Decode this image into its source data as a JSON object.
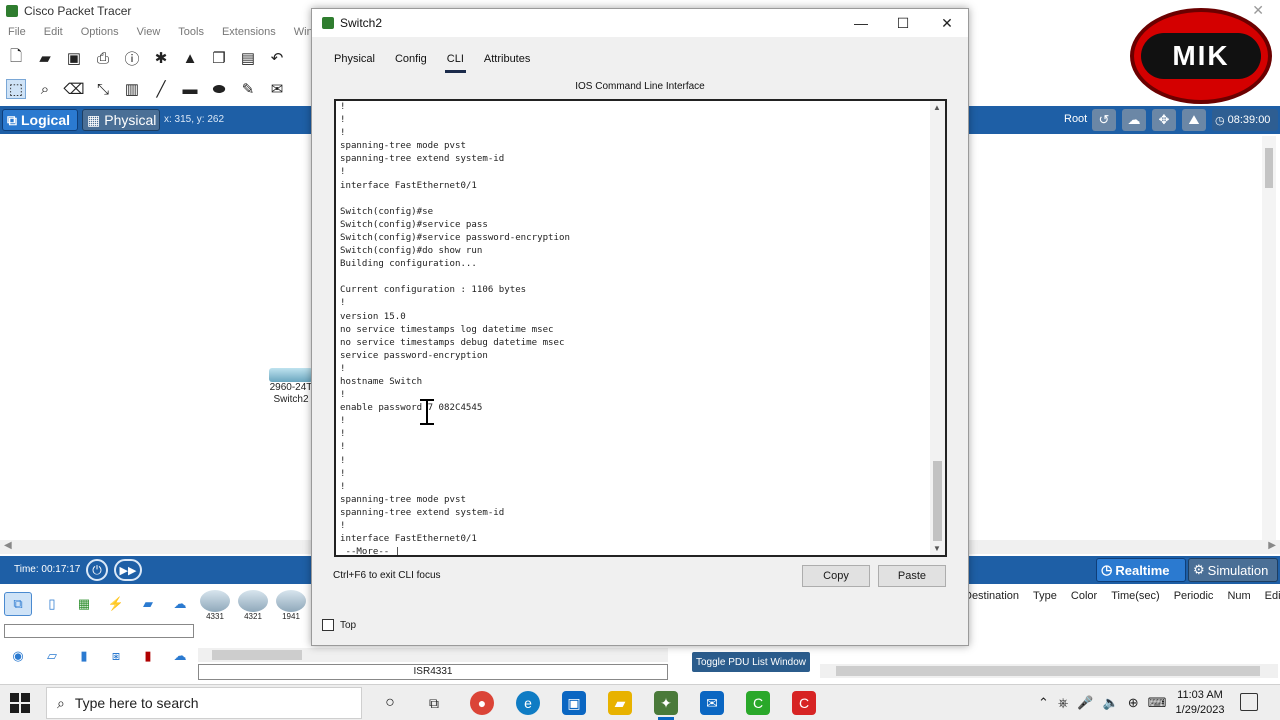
{
  "app": {
    "title": "Cisco Packet Tracer",
    "menu": [
      "File",
      "Edit",
      "Options",
      "View",
      "Tools",
      "Extensions",
      "Window"
    ]
  },
  "workspace": {
    "logical_label": "Logical",
    "physical_label": "Physical",
    "coords": "x: 315, y: 262",
    "root_label": "Root",
    "clock": "08:39:00"
  },
  "canvas": {
    "device_model": "2960-24T",
    "device_name": "Switch2"
  },
  "timebar": {
    "time": "Time: 00:17:17",
    "realtime_label": "Realtime",
    "simulation_label": "Simulation"
  },
  "device_models": [
    {
      "label": "4331"
    },
    {
      "label": "4321"
    },
    {
      "label": "1941"
    }
  ],
  "selected_model": "ISR4331",
  "pdu": {
    "columns": [
      "Destination",
      "Type",
      "Color",
      "Time(sec)",
      "Periodic",
      "Num",
      "Edit"
    ],
    "toggle_label": "Toggle PDU List Window"
  },
  "logo": {
    "text": "MIK"
  },
  "dialog": {
    "title": "Switch2",
    "tabs": [
      "Physical",
      "Config",
      "CLI",
      "Attributes"
    ],
    "active_tab": "CLI",
    "cli_title": "IOS Command Line Interface",
    "cli_text": "!\n!\n!\nspanning-tree mode pvst\nspanning-tree extend system-id\n!\ninterface FastEthernet0/1\n\nSwitch(config)#se\nSwitch(config)#service pass\nSwitch(config)#service password-encryption\nSwitch(config)#do show run\nBuilding configuration...\n\nCurrent configuration : 1106 bytes\n!\nversion 15.0\nno service timestamps log datetime msec\nno service timestamps debug datetime msec\nservice password-encryption\n!\nhostname Switch\n!\nenable password 7 082C4545\n!\n!\n!\n!\n!\n!\nspanning-tree mode pvst\nspanning-tree extend system-id\n!\ninterface FastEthernet0/1\n --More-- |",
    "focus_hint": "Ctrl+F6 to exit CLI focus",
    "copy_label": "Copy",
    "paste_label": "Paste",
    "top_label": "Top"
  },
  "taskbar": {
    "search_placeholder": "Type here to search",
    "time": "11:03 AM",
    "date": "1/29/2023"
  },
  "colors": {
    "pt_blue": "#1e5fa6",
    "button_blue": "#2b7ad0",
    "logo_red": "#d40000"
  }
}
